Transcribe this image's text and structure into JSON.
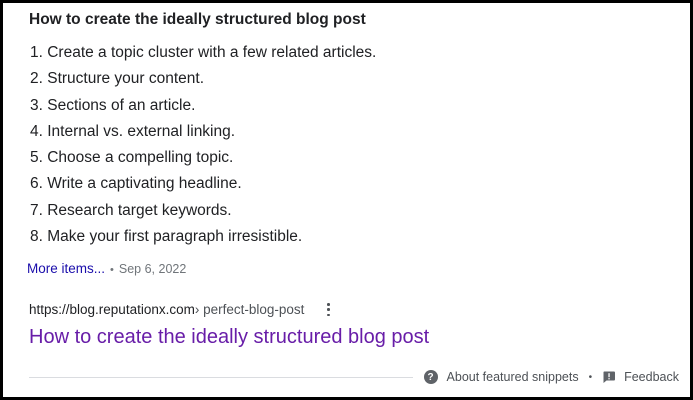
{
  "snippet": {
    "heading": "How to create the ideally structured blog post",
    "steps": [
      "1. Create a topic cluster with a few related articles.",
      "2. Structure your content.",
      "3. Sections of an article.",
      "4. Internal vs. external linking.",
      "5. Choose a compelling topic.",
      "6. Write a captivating headline.",
      "7. Research target keywords.",
      "8. Make your first paragraph irresistible."
    ],
    "more_items_label": "More items...",
    "separator": "•",
    "date": "Sep 6, 2022"
  },
  "result": {
    "domain": "https://blog.reputationx.com",
    "path": " › perfect-blog-post",
    "title": "How to create the ideally structured blog post"
  },
  "footer": {
    "about_label": "About featured snippets",
    "separator": "•",
    "feedback_label": "Feedback"
  },
  "colors": {
    "link": "#1a0dab",
    "visited_link": "#681da8",
    "text": "#202124",
    "muted": "#70757a"
  },
  "icons": {
    "help": "question-circle-icon",
    "feedback": "feedback-icon",
    "more_options": "kebab-menu-icon"
  }
}
